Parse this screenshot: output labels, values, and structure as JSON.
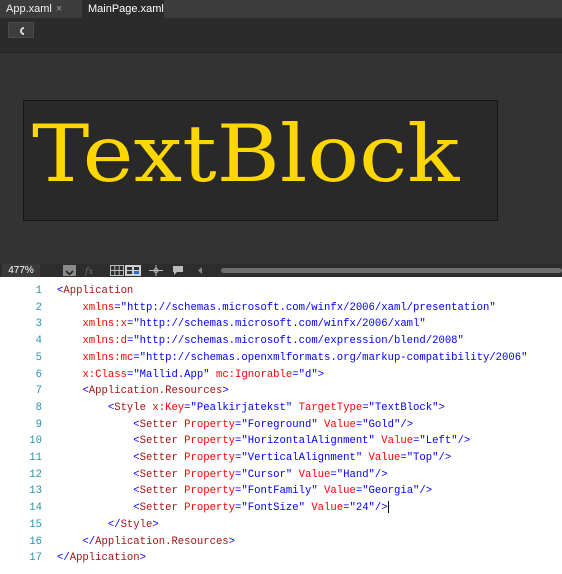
{
  "tabs": [
    {
      "label": "App.xaml",
      "close": "×"
    },
    {
      "label": "MainPage.xaml"
    }
  ],
  "design": {
    "preview_text": "TextBlock",
    "preview_color": "#FFD700",
    "background": "#333333"
  },
  "zoom": {
    "level": "477%"
  },
  "editor": {
    "lines": [
      {
        "n": "1",
        "indent": "",
        "parts": [
          [
            "pun",
            "<"
          ],
          [
            "tag",
            "Application"
          ]
        ]
      },
      {
        "n": "2",
        "indent": "    ",
        "parts": [
          [
            "attr",
            "xmlns"
          ],
          [
            "pun",
            "="
          ],
          [
            "val",
            "\"http://schemas.microsoft.com/winfx/2006/xaml/presentation\""
          ]
        ]
      },
      {
        "n": "3",
        "indent": "    ",
        "parts": [
          [
            "attr",
            "xmlns:x"
          ],
          [
            "pun",
            "="
          ],
          [
            "val",
            "\"http://schemas.microsoft.com/winfx/2006/xaml\""
          ]
        ]
      },
      {
        "n": "4",
        "indent": "    ",
        "parts": [
          [
            "attr",
            "xmlns:d"
          ],
          [
            "pun",
            "="
          ],
          [
            "val",
            "\"http://schemas.microsoft.com/expression/blend/2008\""
          ]
        ]
      },
      {
        "n": "5",
        "indent": "    ",
        "parts": [
          [
            "attr",
            "xmlns:mc"
          ],
          [
            "pun",
            "="
          ],
          [
            "val",
            "\"http://schemas.openxmlformats.org/markup-compatibility/2006\""
          ]
        ]
      },
      {
        "n": "6",
        "indent": "    ",
        "parts": [
          [
            "attr",
            "x:Class"
          ],
          [
            "pun",
            "="
          ],
          [
            "val",
            "\"Mallid.App\""
          ],
          [
            "pun",
            " "
          ],
          [
            "attr",
            "mc:Ignorable"
          ],
          [
            "pun",
            "="
          ],
          [
            "val",
            "\"d\""
          ],
          [
            "pun",
            ">"
          ]
        ]
      },
      {
        "n": "7",
        "indent": "    ",
        "parts": [
          [
            "pun",
            "<"
          ],
          [
            "tag",
            "Application.Resources"
          ],
          [
            "pun",
            ">"
          ]
        ]
      },
      {
        "n": "8",
        "indent": "        ",
        "parts": [
          [
            "pun",
            "<"
          ],
          [
            "tag",
            "Style"
          ],
          [
            "pun",
            " "
          ],
          [
            "attr",
            "x:Key"
          ],
          [
            "pun",
            "="
          ],
          [
            "val",
            "\"Pealkirjatekst\""
          ],
          [
            "pun",
            " "
          ],
          [
            "attr",
            "TargetType"
          ],
          [
            "pun",
            "="
          ],
          [
            "val",
            "\"TextBlock\""
          ],
          [
            "pun",
            ">"
          ]
        ]
      },
      {
        "n": "9",
        "indent": "            ",
        "parts": [
          [
            "pun",
            "<"
          ],
          [
            "tag",
            "Setter"
          ],
          [
            "pun",
            " "
          ],
          [
            "attr",
            "Property"
          ],
          [
            "pun",
            "="
          ],
          [
            "val",
            "\"Foreground\""
          ],
          [
            "pun",
            " "
          ],
          [
            "attr",
            "Value"
          ],
          [
            "pun",
            "="
          ],
          [
            "val",
            "\"Gold\""
          ],
          [
            "pun",
            "/>"
          ]
        ]
      },
      {
        "n": "10",
        "indent": "            ",
        "parts": [
          [
            "pun",
            "<"
          ],
          [
            "tag",
            "Setter"
          ],
          [
            "pun",
            " "
          ],
          [
            "attr",
            "Property"
          ],
          [
            "pun",
            "="
          ],
          [
            "val",
            "\"HorizontalAlignment\""
          ],
          [
            "pun",
            " "
          ],
          [
            "attr",
            "Value"
          ],
          [
            "pun",
            "="
          ],
          [
            "val",
            "\"Left\""
          ],
          [
            "pun",
            "/>"
          ]
        ]
      },
      {
        "n": "11",
        "indent": "            ",
        "parts": [
          [
            "pun",
            "<"
          ],
          [
            "tag",
            "Setter"
          ],
          [
            "pun",
            " "
          ],
          [
            "attr",
            "Property"
          ],
          [
            "pun",
            "="
          ],
          [
            "val",
            "\"VerticalAlignment\""
          ],
          [
            "pun",
            " "
          ],
          [
            "attr",
            "Value"
          ],
          [
            "pun",
            "="
          ],
          [
            "val",
            "\"Top\""
          ],
          [
            "pun",
            "/>"
          ]
        ]
      },
      {
        "n": "12",
        "indent": "            ",
        "parts": [
          [
            "pun",
            "<"
          ],
          [
            "tag",
            "Setter"
          ],
          [
            "pun",
            " "
          ],
          [
            "attr",
            "Property"
          ],
          [
            "pun",
            "="
          ],
          [
            "val",
            "\"Cursor\""
          ],
          [
            "pun",
            " "
          ],
          [
            "attr",
            "Value"
          ],
          [
            "pun",
            "="
          ],
          [
            "val",
            "\"Hand\""
          ],
          [
            "pun",
            "/>"
          ]
        ]
      },
      {
        "n": "13",
        "indent": "            ",
        "parts": [
          [
            "pun",
            "<"
          ],
          [
            "tag",
            "Setter"
          ],
          [
            "pun",
            " "
          ],
          [
            "attr",
            "Property"
          ],
          [
            "pun",
            "="
          ],
          [
            "val",
            "\"FontFamily\""
          ],
          [
            "pun",
            " "
          ],
          [
            "attr",
            "Value"
          ],
          [
            "pun",
            "="
          ],
          [
            "val",
            "\"Georgia\""
          ],
          [
            "pun",
            "/>"
          ]
        ]
      },
      {
        "n": "14",
        "indent": "            ",
        "parts": [
          [
            "pun",
            "<"
          ],
          [
            "tag",
            "Setter"
          ],
          [
            "pun",
            " "
          ],
          [
            "attr",
            "Property"
          ],
          [
            "pun",
            "="
          ],
          [
            "val",
            "\"FontSize\""
          ],
          [
            "pun",
            " "
          ],
          [
            "attr",
            "Value"
          ],
          [
            "pun",
            "="
          ],
          [
            "val",
            "\"24\""
          ],
          [
            "pun",
            "/>"
          ]
        ],
        "caret": true
      },
      {
        "n": "15",
        "indent": "        ",
        "parts": [
          [
            "pun",
            "</"
          ],
          [
            "tag",
            "Style"
          ],
          [
            "pun",
            ">"
          ]
        ]
      },
      {
        "n": "16",
        "indent": "    ",
        "parts": [
          [
            "pun",
            "</"
          ],
          [
            "tag",
            "Application.Resources"
          ],
          [
            "pun",
            ">"
          ]
        ]
      },
      {
        "n": "17",
        "indent": "",
        "parts": [
          [
            "pun",
            "</"
          ],
          [
            "tag",
            "Application"
          ],
          [
            "pun",
            ">"
          ]
        ]
      }
    ],
    "colors": {
      "tag": "#a31515",
      "attr": "#ff0000",
      "value": "#0000ff",
      "line_number": "#2b91af"
    }
  },
  "icons": [
    "back-icon",
    "zoom-dropdown-icon",
    "effects-icon",
    "grid-icon",
    "snap-grid-icon",
    "snap-lines-icon",
    "annotations-icon",
    "scroll-left-icon"
  ]
}
